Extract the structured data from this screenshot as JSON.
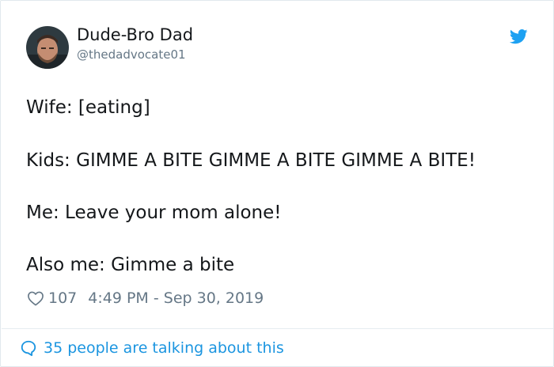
{
  "user": {
    "display_name": "Dude-Bro Dad",
    "handle": "@thedadvocate01"
  },
  "tweet": {
    "lines": [
      "Wife: [eating]",
      "Kids: GIMME A BITE GIMME A BITE GIMME A BITE!",
      "Me: Leave your mom alone!",
      "Also me: Gimme a bite"
    ]
  },
  "meta": {
    "likes": "107",
    "timestamp": "4:49 PM - Sep 30, 2019"
  },
  "discussion": {
    "label": "35 people are talking about this"
  },
  "icons": {
    "brand": "twitter-bird-icon",
    "like": "heart-icon",
    "reply": "speech-bubble-icon"
  },
  "colors": {
    "brand_blue": "#1da1f2",
    "link_blue": "#1b95e0",
    "text": "#14171a",
    "muted": "#657786",
    "border": "#e1e8ed"
  }
}
